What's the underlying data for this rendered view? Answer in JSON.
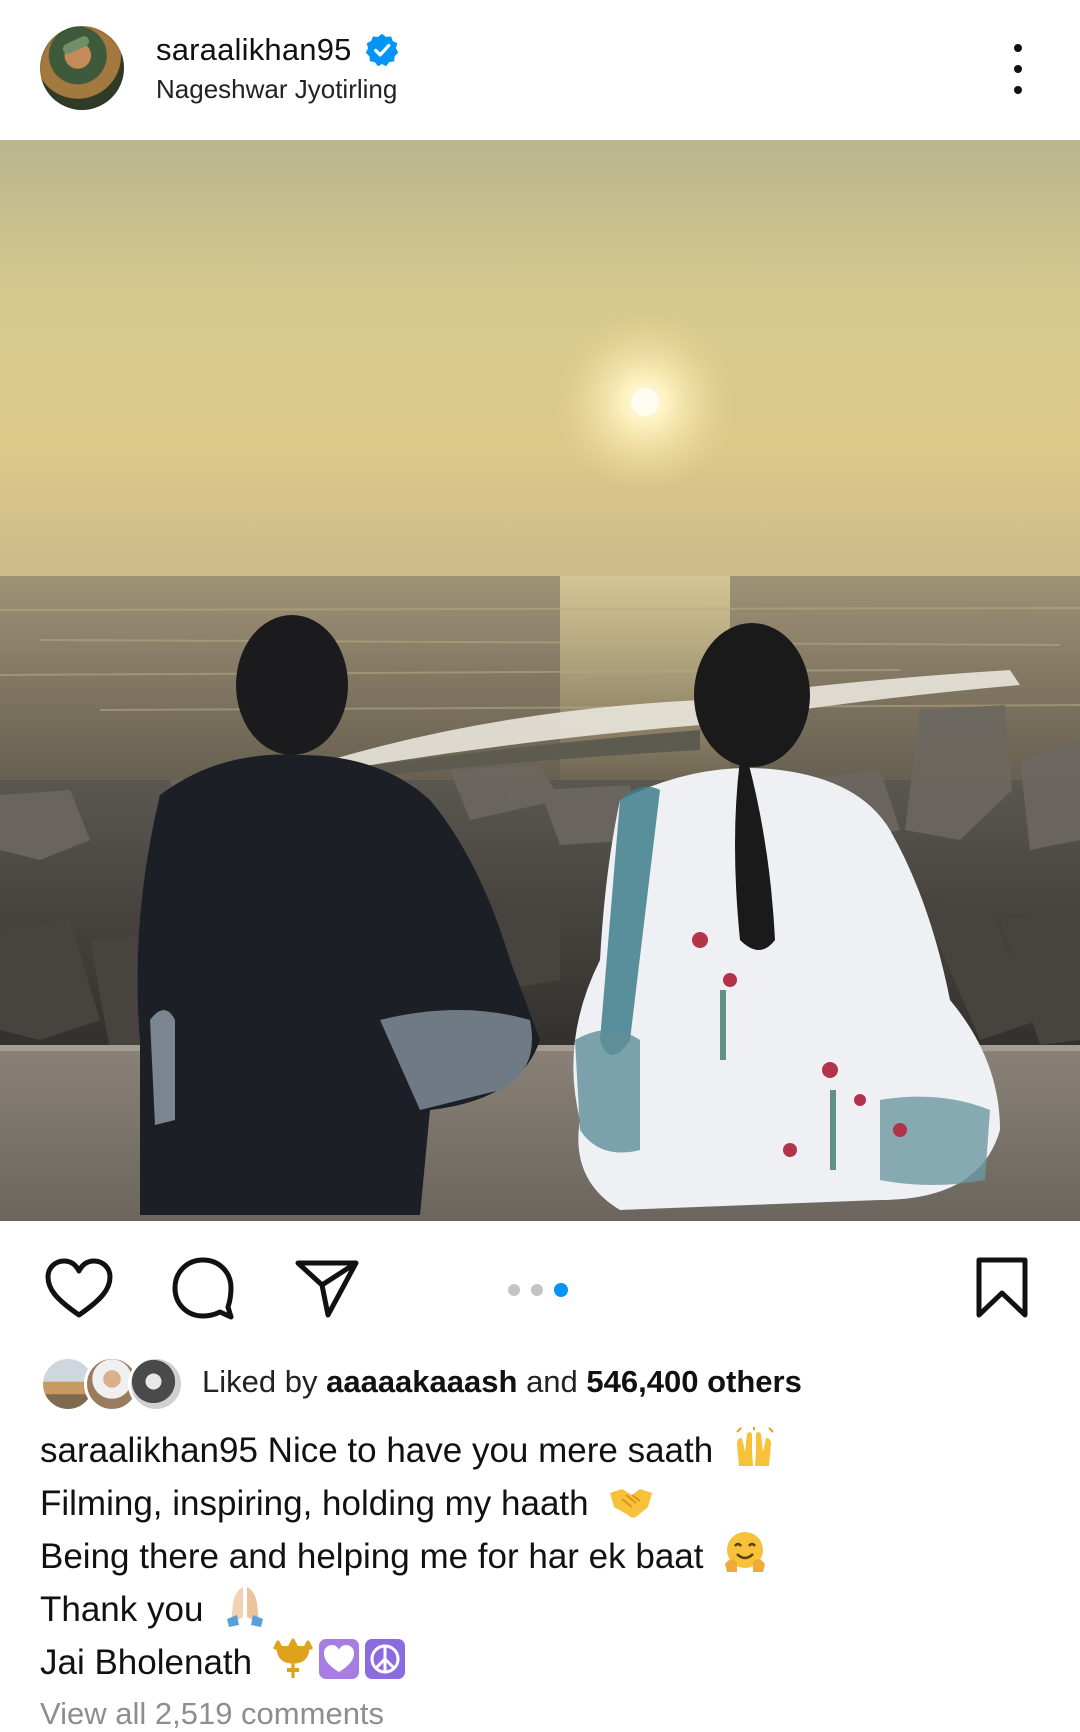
{
  "post": {
    "username": "saraalikhan95",
    "location": "Nageshwar Jyotirling",
    "verified": true
  },
  "photo": {
    "carousel_total": 3,
    "carousel_active_index": 3
  },
  "likes": {
    "prefix": "Liked by",
    "liker": "aaaaakaaash",
    "connector": "and",
    "others": "546,400 others"
  },
  "caption": {
    "handle": "saraalikhan95",
    "lines": [
      "Nice to have you mere saath",
      "Filming, inspiring, holding my haath",
      "Being there and helping me for har ek baat",
      "Thank you",
      "Jai Bholenath"
    ],
    "emojis": [
      "raising-hands",
      "handshake",
      "hugging-face",
      "folded-hands",
      "trident / purple-heart / peace-symbol"
    ]
  },
  "comments": {
    "view_all_label": "View all 2,519 comments"
  },
  "colors": {
    "accent": "#0095f6",
    "verified_badge": "#0095f6",
    "text": "#111111",
    "muted": "#8e8e8e"
  }
}
